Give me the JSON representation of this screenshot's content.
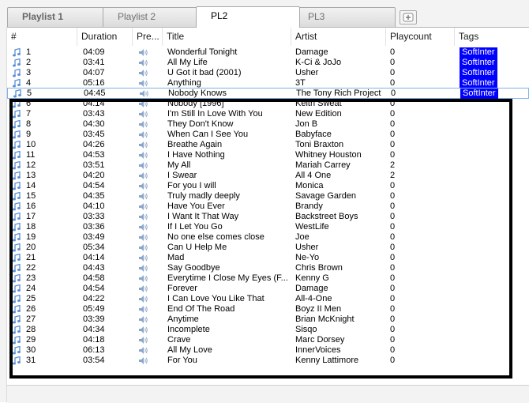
{
  "tabs": [
    {
      "label": "Playlist 1"
    },
    {
      "label": "Playlist 2"
    },
    {
      "label": "PL2"
    },
    {
      "label": "PL3"
    }
  ],
  "columns": {
    "num": "#",
    "duration": "Duration",
    "preview": "Pre...",
    "title": "Title",
    "artist": "Artist",
    "playcount": "Playcount",
    "tags": "Tags"
  },
  "icons": {
    "track": "music-note-icon",
    "preview": "speaker-icon",
    "new_tab": "add-tab-icon"
  },
  "colors": {
    "tag_bg": "#0000ff",
    "tag_fg": "#ffffff",
    "overlay": "#000000"
  },
  "rows": [
    {
      "num": "1",
      "duration": "04:09",
      "title": "Wonderful Tonight",
      "artist": "Damage",
      "playcount": "0",
      "tag": "SoftInter"
    },
    {
      "num": "2",
      "duration": "03:41",
      "title": "All My Life",
      "artist": "K-Ci & JoJo",
      "playcount": "0",
      "tag": "SoftInter"
    },
    {
      "num": "3",
      "duration": "04:07",
      "title": "U Got it bad (2001)",
      "artist": "Usher",
      "playcount": "0",
      "tag": "SoftInter"
    },
    {
      "num": "4",
      "duration": "05:16",
      "title": "Anything",
      "artist": "3T",
      "playcount": "0",
      "tag": "SoftInter"
    },
    {
      "num": "5",
      "duration": "04:45",
      "title": "Nobody Knows",
      "artist": "The Tony Rich Project",
      "playcount": "0",
      "tag": "SoftInter"
    },
    {
      "num": "6",
      "duration": "04:14",
      "title": "Nobody [1996]",
      "artist": "Keith Sweat",
      "playcount": "0",
      "tag": ""
    },
    {
      "num": "7",
      "duration": "03:43",
      "title": "I'm Still In Love With You",
      "artist": "New Edition",
      "playcount": "0",
      "tag": ""
    },
    {
      "num": "8",
      "duration": "04:30",
      "title": "They Don't Know",
      "artist": "Jon B",
      "playcount": "0",
      "tag": ""
    },
    {
      "num": "9",
      "duration": "03:45",
      "title": "When Can I See You",
      "artist": "Babyface",
      "playcount": "0",
      "tag": ""
    },
    {
      "num": "10",
      "duration": "04:26",
      "title": "Breathe Again",
      "artist": "Toni Braxton",
      "playcount": "0",
      "tag": ""
    },
    {
      "num": "11",
      "duration": "04:53",
      "title": "I Have Nothing",
      "artist": "Whitney Houston",
      "playcount": "0",
      "tag": ""
    },
    {
      "num": "12",
      "duration": "03:51",
      "title": "My All",
      "artist": "Mariah Carrey",
      "playcount": "2",
      "tag": ""
    },
    {
      "num": "13",
      "duration": "04:20",
      "title": "I Swear",
      "artist": "All 4 One",
      "playcount": "2",
      "tag": ""
    },
    {
      "num": "14",
      "duration": "04:54",
      "title": "For you I will",
      "artist": "Monica",
      "playcount": "0",
      "tag": ""
    },
    {
      "num": "15",
      "duration": "04:35",
      "title": "Truly madly deeply",
      "artist": "Savage Garden",
      "playcount": "0",
      "tag": ""
    },
    {
      "num": "16",
      "duration": "04:10",
      "title": "Have You Ever",
      "artist": "Brandy",
      "playcount": "0",
      "tag": ""
    },
    {
      "num": "17",
      "duration": "03:33",
      "title": "I Want It That Way",
      "artist": "Backstreet Boys",
      "playcount": "0",
      "tag": ""
    },
    {
      "num": "18",
      "duration": "03:36",
      "title": "If I Let You Go",
      "artist": "WestLife",
      "playcount": "0",
      "tag": ""
    },
    {
      "num": "19",
      "duration": "03:49",
      "title": "No one else comes close",
      "artist": "Joe",
      "playcount": "0",
      "tag": ""
    },
    {
      "num": "20",
      "duration": "05:34",
      "title": "Can U Help Me",
      "artist": "Usher",
      "playcount": "0",
      "tag": ""
    },
    {
      "num": "21",
      "duration": "04:14",
      "title": "Mad",
      "artist": "Ne-Yo",
      "playcount": "0",
      "tag": ""
    },
    {
      "num": "22",
      "duration": "04:43",
      "title": "Say Goodbye",
      "artist": "Chris Brown",
      "playcount": "0",
      "tag": ""
    },
    {
      "num": "23",
      "duration": "04:58",
      "title": "Everytime I Close My Eyes (F...",
      "artist": "Kenny G",
      "playcount": "0",
      "tag": ""
    },
    {
      "num": "24",
      "duration": "04:54",
      "title": "Forever",
      "artist": "Damage",
      "playcount": "0",
      "tag": ""
    },
    {
      "num": "25",
      "duration": "04:22",
      "title": "I Can Love You Like That",
      "artist": "All-4-One",
      "playcount": "0",
      "tag": ""
    },
    {
      "num": "26",
      "duration": "05:49",
      "title": "End Of The Road",
      "artist": "Boyz II Men",
      "playcount": "0",
      "tag": ""
    },
    {
      "num": "27",
      "duration": "03:39",
      "title": "Anytime",
      "artist": "Brian McKnight",
      "playcount": "0",
      "tag": ""
    },
    {
      "num": "28",
      "duration": "04:34",
      "title": "Incomplete",
      "artist": "Sisqo",
      "playcount": "0",
      "tag": ""
    },
    {
      "num": "29",
      "duration": "04:18",
      "title": "Crave",
      "artist": "Marc Dorsey",
      "playcount": "0",
      "tag": ""
    },
    {
      "num": "30",
      "duration": "06:13",
      "title": "All My Love",
      "artist": "InnerVoices",
      "playcount": "0",
      "tag": ""
    },
    {
      "num": "31",
      "duration": "03:54",
      "title": "For You",
      "artist": "Kenny Lattimore",
      "playcount": "0",
      "tag": ""
    }
  ]
}
